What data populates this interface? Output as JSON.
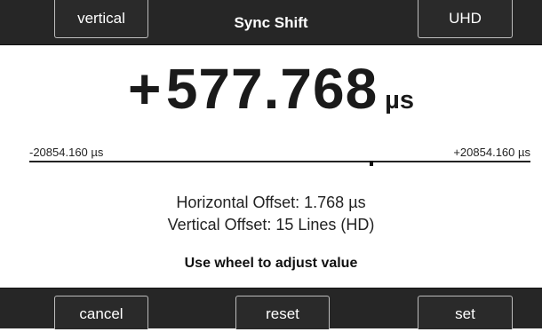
{
  "header": {
    "left_button": "vertical",
    "title": "Sync Shift",
    "right_button": "UHD"
  },
  "value": {
    "sign": "+",
    "number": "577.768",
    "unit": "µs"
  },
  "scale": {
    "min_label": "-20854.160 µs",
    "max_label": "+20854.160 µs"
  },
  "info": {
    "horizontal_offset": "Horizontal Offset: 1.768 µs",
    "vertical_offset": "Vertical Offset: 15 Lines (HD)"
  },
  "hint": "Use wheel to adjust value",
  "footer": {
    "cancel": "cancel",
    "reset": "reset",
    "set": "set"
  }
}
